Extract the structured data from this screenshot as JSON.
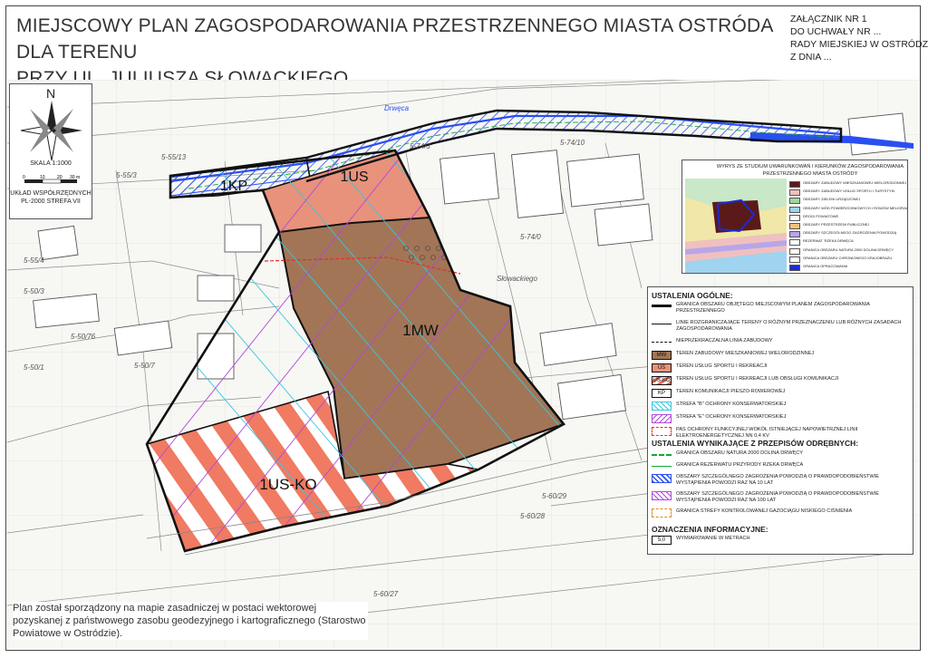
{
  "header": {
    "title_line1": "MIEJSCOWY PLAN ZAGOSPODAROWANIA PRZESTRZENNEGO MIASTA OSTRÓDA DLA TERENU",
    "title_line2": "PRZY UL. JULIUSZA SŁOWACKIEGO",
    "attachment": [
      "ZAŁĄCZNIK NR 1",
      "DO UCHWAŁY NR ...",
      "RADY MIEJSKIEJ W OSTRÓDZIE",
      "Z DNIA  ..."
    ]
  },
  "compass": {
    "north": "N",
    "scale_label": "SKALA 1:1000",
    "scale_ticks": [
      "0",
      "10",
      "20",
      "30 m"
    ],
    "coord_system": [
      "UKŁAD WSPÓŁRZĘDNYCH",
      "PL-2000 STREFA VII"
    ]
  },
  "zones": {
    "mw": "1MW",
    "us": "1US",
    "uskp": "1US-KO",
    "kp": "1KP"
  },
  "map_labels": {
    "parcels": [
      "5-55/3",
      "5-55/4",
      "5-50/76",
      "5-50/7",
      "5-50/1",
      "5-55/13",
      "5-74/3",
      "5-74/0",
      "5-74/10",
      "5-60/28",
      "5-60/29",
      "5-60/27",
      "5-50/3"
    ],
    "street": "Słowackiego",
    "river": "Drwęca"
  },
  "inset": {
    "title": "WYRYS ZE STUDIUM UWARUNKOWAŃ I KIERUNKÓW ZAGOSPODAROWANIA PRZESTRZENNEGO MIASTA OSTRÓDY",
    "items": [
      {
        "label": "OBSZARY ZABUDOWY MIESZKANIOWEJ WIELORODZINNEJ",
        "color": "#5a1a1a"
      },
      {
        "label": "OBSZARY ZABUDOWY USŁUG SPORTU I TURYSTYKI",
        "color": "#f0c0c0"
      },
      {
        "label": "OBSZARY ZIELENI URZĄDZONEJ",
        "color": "#9fd89f"
      },
      {
        "label": "OBSZARY WÓD POWIERZCHNIOWYCH I ROWÓW MELIORACYJNYCH",
        "color": "#9fd3f0"
      },
      {
        "label": "DROGI POWIATOWE",
        "color": "#ffffff"
      },
      {
        "label": "OBSZARY PRZESTRZENI PUBLICZNEJ",
        "color": "#f4c37a"
      },
      {
        "label": "OBSZARY SZCZEGÓLNEGO ZAGROŻENIA POWODZIĄ",
        "color": "#b7a6e8"
      },
      {
        "label": "REZERWAT 'RZEKA DRWĘCA'",
        "color": "#ffffff"
      },
      {
        "label": "GRANICA OBSZARU NATURA 2000 DOLINA DRWĘCY",
        "color": "#ffffff"
      },
      {
        "label": "GRANICA OBSZARU CHRONIONEGO KRAJOBRAZU",
        "color": "#ffffff"
      },
      {
        "label": "GRANICA OPRACOWANIA",
        "color": "#1a2bd6"
      }
    ]
  },
  "legend": {
    "general_heading": "USTALENIA OGÓLNE:",
    "general": [
      {
        "code": "",
        "label": "GRANICA OBSZARU OBJĘTEGO MIEJSCOWYM PLANEM ZAGOSPODAROWANIA PRZESTRZENNEGO",
        "swatch": "boundary"
      },
      {
        "code": "",
        "label": "LINIE ROZGRANICZAJĄCE TERENY O RÓŻNYM PRZEZNACZENIU LUB RÓŻNYCH ZASADACH ZAGOSPODAROWANIA",
        "swatch": "line"
      },
      {
        "code": "",
        "label": "NIEPRZEKRACZALNA LINIA ZABUDOWY",
        "swatch": "dashed"
      },
      {
        "code": "MW",
        "label": "TEREN ZABUDOWY MIESZKANIOWEJ WIELORODZINNEJ",
        "swatch": "mw"
      },
      {
        "code": "US",
        "label": "TEREN USŁUG SPORTU I REKREACJI",
        "swatch": "us"
      },
      {
        "code": "US-KO",
        "label": "TEREN USŁUG SPORTU I REKREACJI LUB OBSŁUGI KOMUNIKACJI",
        "swatch": "usko"
      },
      {
        "code": "KP",
        "label": "TEREN KOMUNIKACJI PIESZO-ROWEROWEJ",
        "swatch": "kp"
      },
      {
        "code": "",
        "label": "STREFA \"B\" OCHRONY KONSERWATORSKIEJ",
        "swatch": "strefab"
      },
      {
        "code": "",
        "label": "STREFA \"E\" OCHRONY KONSERWATORSKIEJ",
        "swatch": "strefae"
      },
      {
        "code": "",
        "label": "PAS OCHRONY FUNKCYJNEJ WOKÓŁ ISTNIEJĄCEJ NAPOWIETRZNEJ LINII ELEKTROENERGETYCZNEJ nn 0,4 kV",
        "swatch": "pas"
      }
    ],
    "other_heading": "USTALENIA WYNIKAJĄCE Z PRZEPISÓW ODRĘBNYCH:",
    "other": [
      {
        "label": "GRANICA OBSZARU NATURA 2000 DOLINA DRWĘCY",
        "swatch": "natura"
      },
      {
        "label": "GRANICA REZERWATU PRZYRODY RZEKA DRWĘCA",
        "swatch": "rezerwat"
      },
      {
        "label": "OBSZARY SZCZEGÓLNEGO ZAGROŻENIA POWODZIĄ O PRAWDOPODOBIEŃSTWIE WYSTĄPIENIA POWODZI RAZ NA 10 LAT",
        "swatch": "flood10"
      },
      {
        "label": "OBSZARY SZCZEGÓLNEGO ZAGROŻENIA POWODZIĄ O PRAWDOPODOBIEŃSTWIE WYSTĄPIENIA POWODZI RAZ NA 100 LAT",
        "swatch": "flood100"
      },
      {
        "label": "GRANICA STREFY KONTROLOWANEJ GAZOCIĄGU NISKIEGO CIŚNIENIA",
        "swatch": "gas"
      }
    ],
    "info_heading": "OZNACZENIA INFORMACYJNE:",
    "info": [
      {
        "code": "5,0",
        "label": "WYMIAROWANIE W METRACH",
        "swatch": "dim"
      }
    ]
  },
  "note": "Plan został sporządzony na mapie zasadniczej w postaci wektorowej pozyskanej z państwowego zasobu geodezyjnego i kartograficznego (Starostwo Powiatowe w Ostródzie).",
  "colors": {
    "mw": "#a27557",
    "us": "#e8927b",
    "stripe": "#f06a55",
    "boundary": "#111111",
    "flood": "#2a4ff0",
    "strefa_b": "#36c8e0",
    "strefa_e": "#b04ad8",
    "natura": "#17a53a",
    "pas": "#e0302a"
  }
}
